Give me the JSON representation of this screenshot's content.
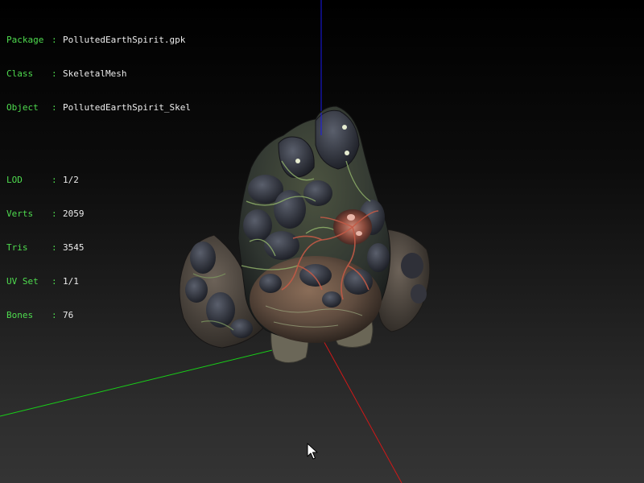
{
  "window": {
    "background_top": "#000000",
    "background_bottom": "#343434"
  },
  "info_overlay": {
    "label_color": "#4fdc4f",
    "value_color": "#ececec",
    "separator": ":",
    "asset_rows": [
      {
        "label": "Package",
        "value": "PollutedEarthSpirit.gpk"
      },
      {
        "label": "Class",
        "value": "SkeletalMesh"
      },
      {
        "label": "Object",
        "value": "PollutedEarthSpirit_Skel"
      }
    ],
    "mesh_rows": [
      {
        "label": "LOD",
        "value": "1/2"
      },
      {
        "label": "Verts",
        "value": "2059"
      },
      {
        "label": "Tris",
        "value": "3545"
      },
      {
        "label": "UV Set",
        "value": "1/1"
      },
      {
        "label": "Bones",
        "value": "76"
      }
    ]
  },
  "axes": {
    "x_color": "#d01818",
    "y_color": "#18d018",
    "z_color": "#1a1aee"
  },
  "cursor": {
    "icon": "arrow-pointer-icon"
  }
}
